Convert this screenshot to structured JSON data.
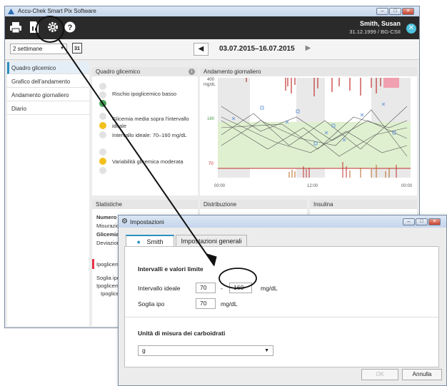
{
  "main_window": {
    "title": "Accu-Chek Smart Pix Software",
    "user_name": "Smith, Susan",
    "user_sub": "31.12.1999 / BG-CSII",
    "period": "2 settimane",
    "date_range": "03.07.2015–16.07.2015",
    "calendar_day": "31"
  },
  "sidebar": {
    "items": [
      {
        "label": "Quadro glicemico"
      },
      {
        "label": "Grafico dell'andamento"
      },
      {
        "label": "Andamento giornaliero"
      },
      {
        "label": "Diario"
      }
    ]
  },
  "quadro": {
    "title": "Quadro glicemico",
    "items": [
      {
        "text": "Rischio ipoglicemico basso"
      },
      {
        "text": "Glicemia media sopra l'intervallo ideale"
      },
      {
        "text": "Intervallo ideale: 70–160 mg/dL"
      },
      {
        "text": "Variabilità glicemica moderata"
      }
    ]
  },
  "andamento": {
    "title": "Andamento giornaliero",
    "y_top": "400",
    "y_unit": "mg/dL",
    "y_target": "160",
    "y_low": "70",
    "x_labels": [
      "00:00",
      "12:00",
      "00:00"
    ]
  },
  "bottom_panels": {
    "statistiche": "Statistiche",
    "distribuzione": "Distribuzione",
    "insulina": "Insulina",
    "stat_lines": [
      "Numero d",
      "Misurazio",
      "Glicemia",
      "Deviazion"
    ],
    "ipo_title": "Ipoglicem",
    "ipo_lines": [
      "Soglia ipo",
      "Ipoglicem",
      "Ipoglice"
    ]
  },
  "dialog": {
    "title": "Impostazioni",
    "tabs": [
      {
        "label": "Smith"
      },
      {
        "label": "Impostazioni generali"
      }
    ],
    "section_limits": "Intervalli e valori limite",
    "ideal_label": "Intervallo ideale",
    "ideal_low": "70",
    "ideal_sep": "-",
    "ideal_high": "160",
    "unit": "mg/dL",
    "hypo_label": "Soglia ipo",
    "hypo_value": "70",
    "section_carbs": "Unità di misura dei carboidrati",
    "carbs_value": "g",
    "ok_label": "OK",
    "cancel_label": "Annulla"
  }
}
